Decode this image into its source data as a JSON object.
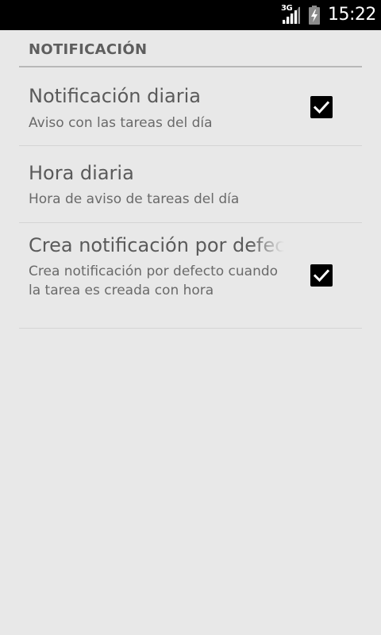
{
  "status_bar": {
    "network_type": "3G",
    "time": "15:22",
    "signal_icon": "signal-icon",
    "battery_icon": "battery-charging-icon"
  },
  "category": {
    "title": "NOTIFICACIÓN"
  },
  "preferences": [
    {
      "title": "Notificación diaria",
      "summary": "Aviso con las tareas del día",
      "has_checkbox": true,
      "checked": true
    },
    {
      "title": "Hora diaria",
      "summary": "Hora de aviso de tareas del día",
      "has_checkbox": false
    },
    {
      "title": "Crea notificación por defecto",
      "summary": "Crea notificación por defecto cuando la tarea es creada con hora",
      "has_checkbox": true,
      "checked": true
    }
  ],
  "colors": {
    "background": "#e8e8e8",
    "status_bar": "#000000",
    "checkbox": "#000000"
  }
}
